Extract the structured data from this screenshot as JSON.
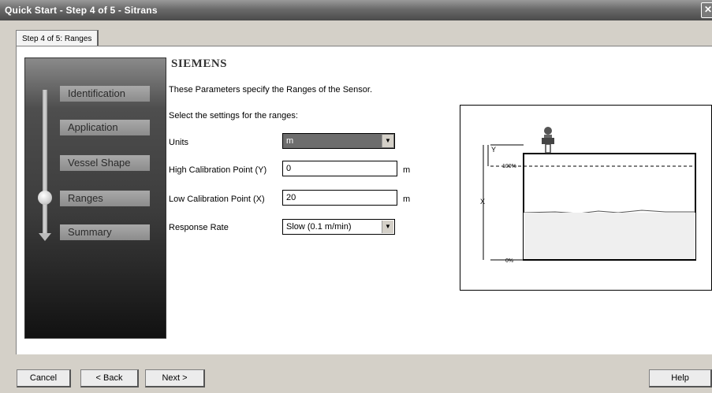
{
  "window": {
    "title": "Quick Start - Step 4 of 5 - Sitrans",
    "close_glyph": "✕"
  },
  "tab": {
    "label": "Step 4 of 5: Ranges"
  },
  "nav": {
    "items": [
      "Identification",
      "Application",
      "Vessel Shape",
      "Ranges",
      "Summary"
    ],
    "current": "Ranges"
  },
  "brand": "SIEMENS",
  "intro": "These Parameters specify the Ranges of the Sensor.",
  "prompt": "Select the settings for the ranges:",
  "form": {
    "units": {
      "label": "Units",
      "value": "m"
    },
    "high_cal": {
      "label": "High Calibration Point (Y)",
      "value": "0",
      "unit": "m"
    },
    "low_cal": {
      "label": "Low Calibration Point (X)",
      "value": "20",
      "unit": "m"
    },
    "response": {
      "label": "Response Rate",
      "value": "Slow (0.1 m/min)"
    }
  },
  "diagram": {
    "y_label": "Y",
    "x_label": "X",
    "top_label": "100%",
    "bottom_label": "0%"
  },
  "buttons": {
    "cancel": "Cancel",
    "back": "< Back",
    "next": "Next >",
    "help": "Help"
  }
}
